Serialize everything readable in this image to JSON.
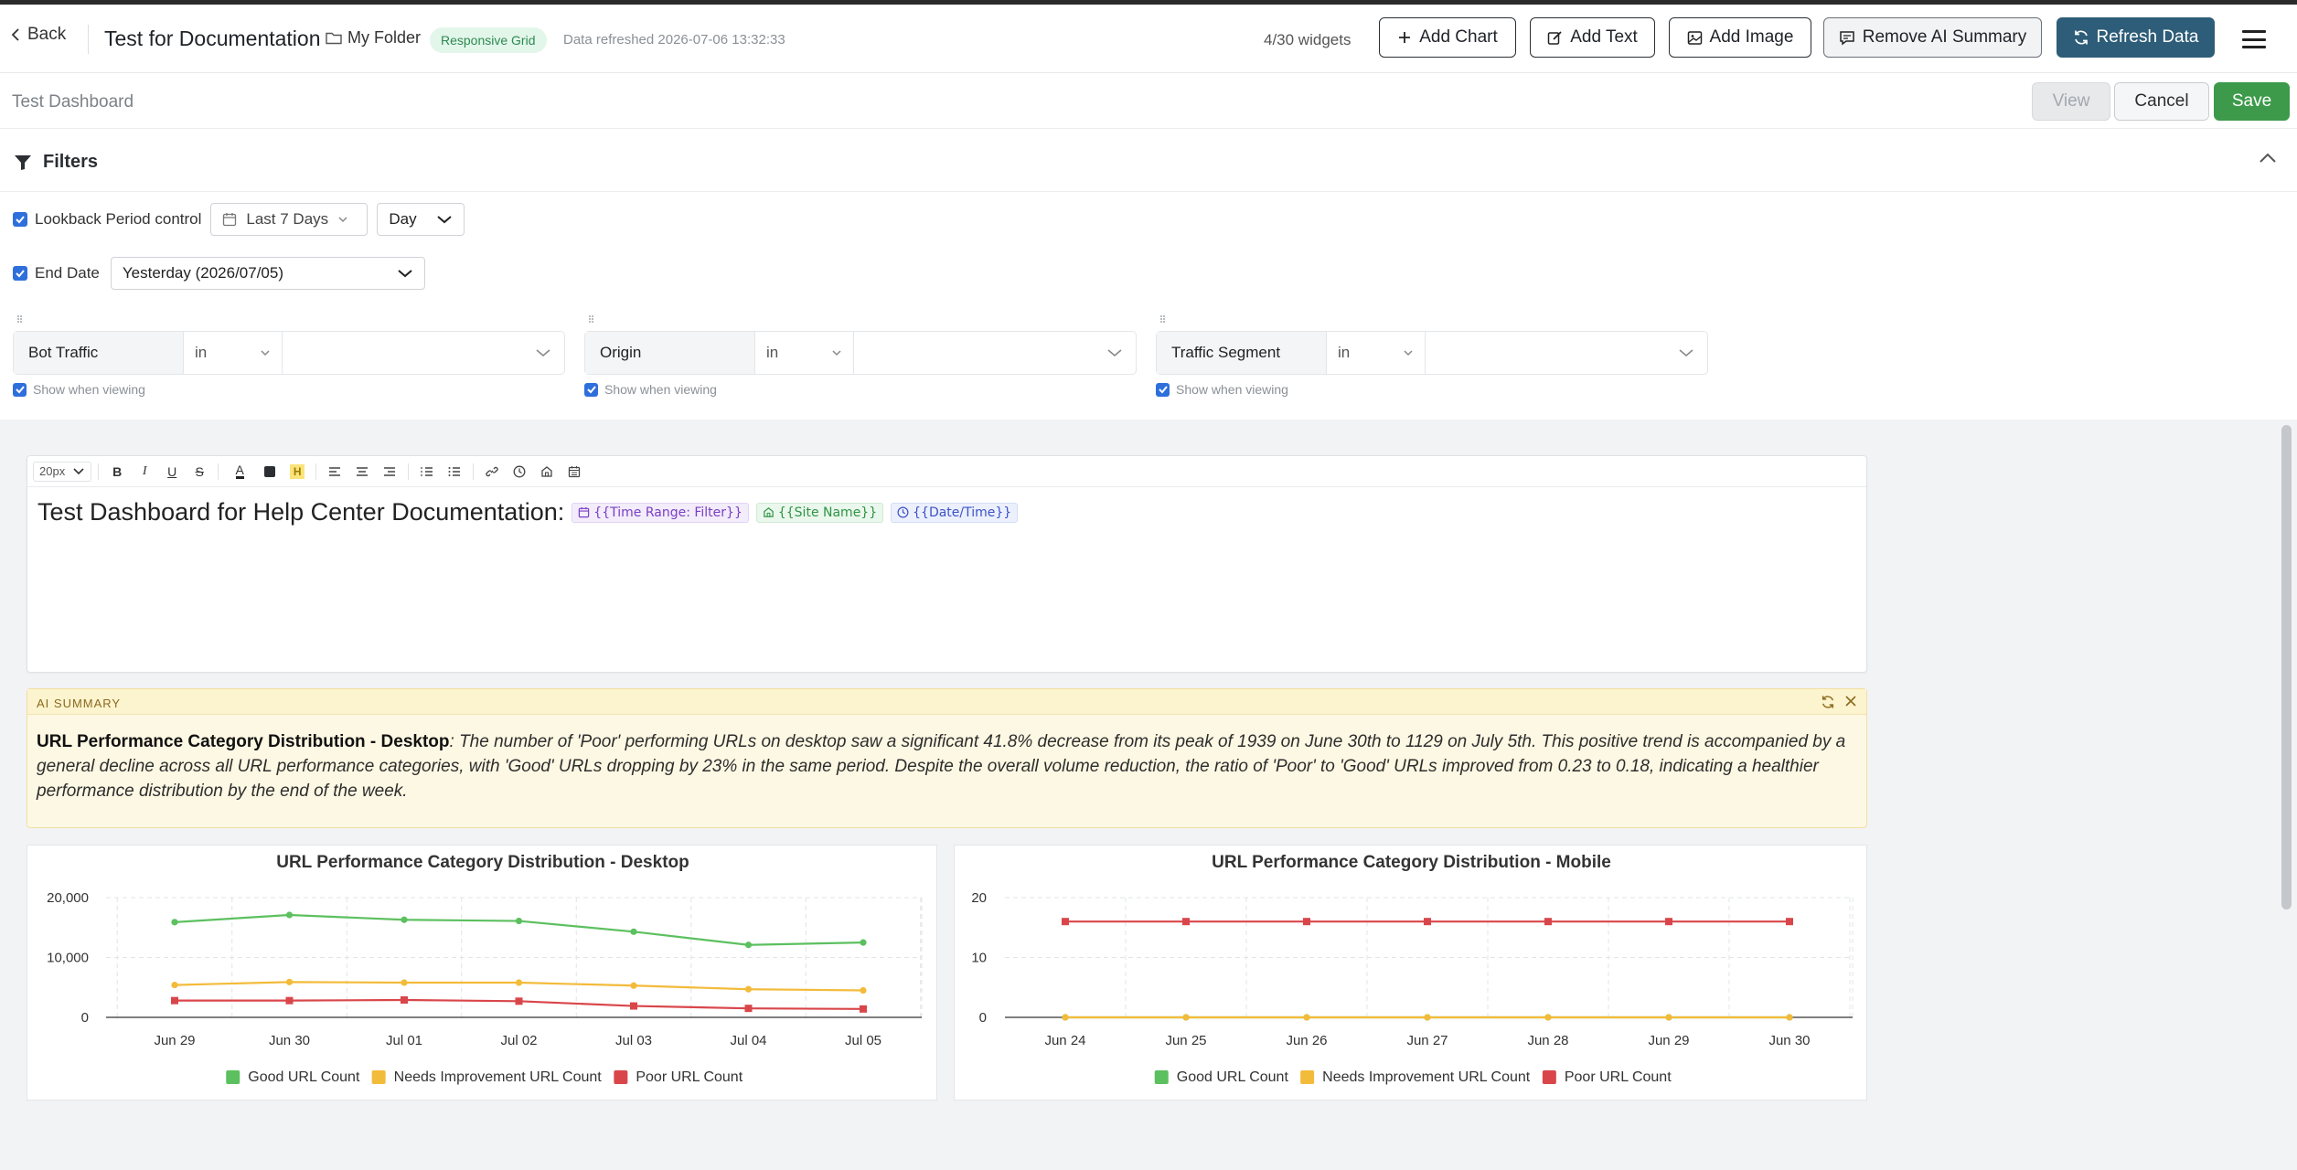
{
  "header": {
    "back_label": "Back",
    "title": "Test for Documentation",
    "folder": "My Folder",
    "layout_badge": "Responsive Grid",
    "refreshed": "Data refreshed 2026-07-06 13:32:33",
    "widget_count": "4/30 widgets",
    "add_chart": "Add Chart",
    "add_text": "Add Text",
    "add_image": "Add Image",
    "remove_ai": "Remove AI Summary",
    "refresh": "Refresh Data"
  },
  "subheader": {
    "dashboard_name": "Test Dashboard",
    "view": "View",
    "cancel": "Cancel",
    "save": "Save"
  },
  "filters": {
    "title": "Filters",
    "lookback_label": "Lookback Period control",
    "lookback_value": "Last 7 Days",
    "granularity": "Day",
    "end_date_label": "End Date",
    "end_date_value": "Yesterday (2026/07/05)",
    "groups": [
      {
        "name": "Bot Traffic",
        "op": "in",
        "show": "Show when viewing"
      },
      {
        "name": "Origin",
        "op": "in",
        "show": "Show when viewing"
      },
      {
        "name": "Traffic Segment",
        "op": "in",
        "show": "Show when viewing"
      }
    ]
  },
  "editor": {
    "font_size": "20px",
    "text": "Test Dashboard for Help Center Documentation:",
    "tags": [
      "{{Time Range: Filter}}",
      "{{Site Name}}",
      "{{Date/Time}}"
    ]
  },
  "ai_summary": {
    "label": "AI SUMMARY",
    "heading": "URL Performance Category Distribution - Desktop",
    "body": ": The number of 'Poor' performing URLs on desktop saw a significant 41.8% decrease from its peak of 1939 on June 30th to 1129 on July 5th. This positive trend is accompanied by a general decline across all URL performance categories, with 'Good' URLs dropping by 23% in the same period. Despite the overall volume reduction, the ratio of 'Poor' to 'Good' URLs improved from 0.23 to 0.18, indicating a healthier performance distribution by the end of the week."
  },
  "colors": {
    "good": "#5cc05f",
    "needs": "#f3bb3a",
    "poor": "#d9464a",
    "primary": "#2d5d78",
    "save": "#3c9a4a"
  },
  "chart_data": [
    {
      "type": "line",
      "title": "URL Performance Category Distribution - Desktop",
      "categories": [
        "Jun 29",
        "Jun 30",
        "Jul 01",
        "Jul 02",
        "Jul 03",
        "Jul 04",
        "Jul 05"
      ],
      "ylim": [
        0,
        20000
      ],
      "yticks": [
        "0",
        "10,000",
        "20,000"
      ],
      "grid": true,
      "legend": "bottom",
      "series": [
        {
          "name": "Good URL Count",
          "values": [
            15900,
            17100,
            16300,
            16100,
            14300,
            12100,
            12500
          ]
        },
        {
          "name": "Needs Improvement URL Count",
          "values": [
            5400,
            5900,
            5800,
            5800,
            5300,
            4700,
            4500
          ]
        },
        {
          "name": "Poor URL Count",
          "values": [
            2800,
            2800,
            2900,
            2700,
            1900,
            1500,
            1400
          ]
        }
      ]
    },
    {
      "type": "line",
      "title": "URL Performance Category Distribution - Mobile",
      "categories": [
        "Jun 24",
        "Jun 25",
        "Jun 26",
        "Jun 27",
        "Jun 28",
        "Jun 29",
        "Jun 30"
      ],
      "ylim": [
        0,
        20
      ],
      "yticks": [
        "0",
        "10",
        "20"
      ],
      "grid": true,
      "legend": "bottom",
      "series": [
        {
          "name": "Good URL Count",
          "values": [
            0,
            0,
            0,
            0,
            0,
            0,
            0
          ]
        },
        {
          "name": "Needs Improvement URL Count",
          "values": [
            0,
            0,
            0,
            0,
            0,
            0,
            0
          ]
        },
        {
          "name": "Poor URL Count",
          "values": [
            16,
            16,
            16,
            16,
            16,
            16,
            16
          ]
        }
      ]
    }
  ]
}
